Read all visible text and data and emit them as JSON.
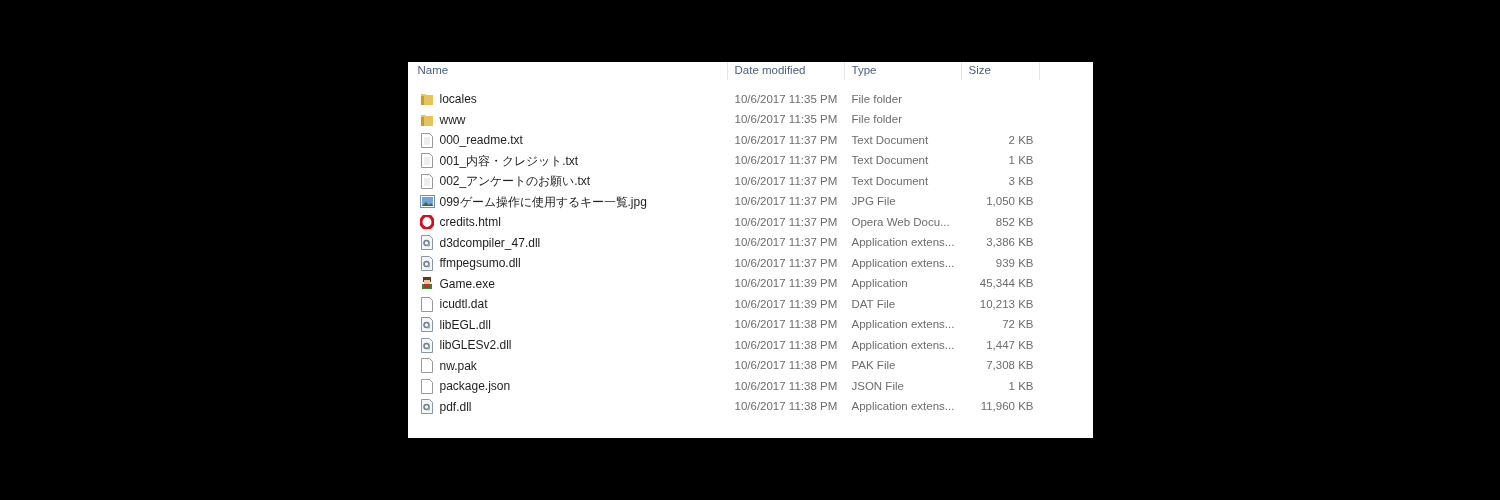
{
  "columns": [
    "Name",
    "Date modified",
    "Type",
    "Size"
  ],
  "rows": [
    {
      "kind": "folder",
      "name": "locales",
      "date": "10/6/2017 11:35 PM",
      "type": "File folder"
    },
    {
      "kind": "folder",
      "name": "www",
      "date": "10/6/2017 11:35 PM",
      "type": "File folder"
    },
    {
      "kind": "text",
      "name": "000_readme.txt",
      "date": "10/6/2017 11:37 PM",
      "type": "Text Document",
      "size": "2 KB"
    },
    {
      "kind": "text",
      "name": "001_内容・クレジット.txt",
      "date": "10/6/2017 11:37 PM",
      "type": "Text Document",
      "size": "1 KB"
    },
    {
      "kind": "text",
      "name": "002_アンケートのお願い.txt",
      "date": "10/6/2017 11:37 PM",
      "type": "Text Document",
      "size": "3 KB"
    },
    {
      "kind": "image",
      "name": "099ゲーム操作に使用するキー一覧.jpg",
      "date": "10/6/2017 11:37 PM",
      "type": "JPG File",
      "size": "1,050 KB"
    },
    {
      "kind": "opera",
      "name": "credits.html",
      "date": "10/6/2017 11:37 PM",
      "type": "Opera Web Docu...",
      "size": "852 KB"
    },
    {
      "kind": "dll",
      "name": "d3dcompiler_47.dll",
      "date": "10/6/2017 11:37 PM",
      "type": "Application extens...",
      "size": "3,386 KB"
    },
    {
      "kind": "dll",
      "name": "ffmpegsumo.dll",
      "date": "10/6/2017 11:37 PM",
      "type": "Application extens...",
      "size": "939 KB"
    },
    {
      "kind": "game",
      "name": "Game.exe",
      "date": "10/6/2017 11:39 PM",
      "type": "Application",
      "size": "45,344 KB"
    },
    {
      "kind": "blank",
      "name": "icudtl.dat",
      "date": "10/6/2017 11:39 PM",
      "type": "DAT File",
      "size": "10,213 KB"
    },
    {
      "kind": "dll",
      "name": "libEGL.dll",
      "date": "10/6/2017 11:38 PM",
      "type": "Application extens...",
      "size": "72 KB"
    },
    {
      "kind": "dll",
      "name": "libGLESv2.dll",
      "date": "10/6/2017 11:38 PM",
      "type": "Application extens...",
      "size": "1,447 KB"
    },
    {
      "kind": "blank",
      "name": "nw.pak",
      "date": "10/6/2017 11:38 PM",
      "type": "PAK File",
      "size": "7,308 KB"
    },
    {
      "kind": "blank",
      "name": "package.json",
      "date": "10/6/2017 11:38 PM",
      "type": "JSON File",
      "size": "1 KB"
    },
    {
      "kind": "dll",
      "name": "pdf.dll",
      "date": "10/6/2017 11:38 PM",
      "type": "Application extens...",
      "size": "11,960 KB"
    }
  ]
}
